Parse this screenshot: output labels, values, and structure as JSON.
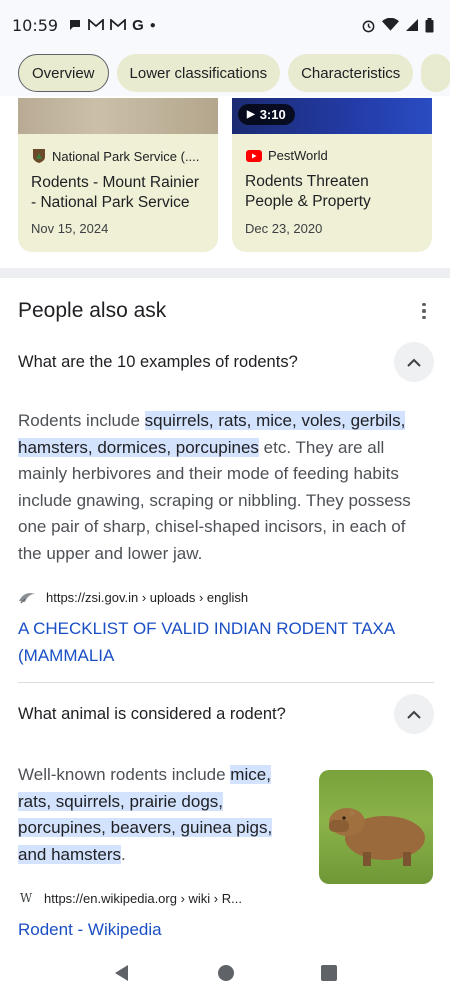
{
  "status_bar": {
    "time": "10:59",
    "left_icons": [
      "chat-icon",
      "gmail-icon",
      "gmail-icon",
      "google-icon",
      "dot-icon"
    ],
    "right_icons": [
      "alarm-icon",
      "wifi-icon",
      "signal-icon",
      "battery-icon"
    ]
  },
  "chips": [
    {
      "label": "Overview",
      "active": true
    },
    {
      "label": "Lower classifications",
      "active": false
    },
    {
      "label": "Characteristics",
      "active": false
    }
  ],
  "cards": [
    {
      "source": "National Park Service (....",
      "title": "Rodents - Mount Rainier - National Park Service",
      "date": "Nov 15, 2024"
    },
    {
      "duration": "3:10",
      "source": "PestWorld",
      "title": "Rodents Threaten People & Property",
      "date": "Dec 23, 2020"
    }
  ],
  "paa": {
    "title": "People also ask",
    "items": [
      {
        "question": "What are the 10 examples of rodents?",
        "answer_pre": "Rodents include ",
        "answer_highlight": "squirrels, rats, mice, voles, gerbils, hamsters, dormices, porcupines",
        "answer_post": " etc. They are all mainly herbivores and their mode of feeding habits include gnawing, scraping or nibbling. They possess one pair of sharp, chisel-shaped incisors, in each of the upper and lower jaw.",
        "source_url": "https://zsi.gov.in › uploads › english",
        "link_title": "A CHECKLIST OF VALID INDIAN RODENT TAXA (MAMMALIA"
      },
      {
        "question": "What animal is considered a rodent?",
        "answer_pre": "Well-known rodents include ",
        "answer_highlight": "mice, rats, squirrels, prairie dogs, porcupines, beavers, guinea pigs, and hamsters",
        "answer_post": ".",
        "source_favicon": "W",
        "source_url": "https://en.wikipedia.org › wiki › R...",
        "link_title": "Rodent - Wikipedia"
      }
    ]
  },
  "colors": {
    "chip_bg": "#e8ebcf",
    "card_bg": "#eff0d5",
    "highlight": "#d3e3fd",
    "link": "#1a4fc4"
  }
}
